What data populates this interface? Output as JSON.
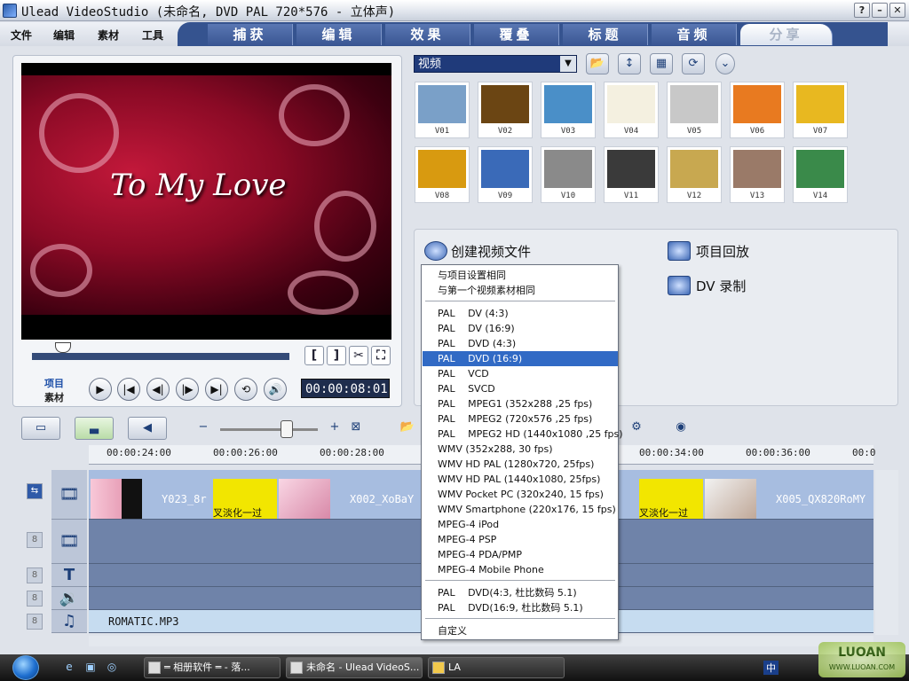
{
  "window": {
    "title": "Ulead VideoStudio (未命名, DVD PAL 720*576 - 立体声)",
    "help": "?",
    "minimize": "–",
    "close": "✕"
  },
  "menu": [
    "文件",
    "编辑",
    "素材",
    "工具"
  ],
  "tabs": [
    "捕获",
    "编辑",
    "效果",
    "覆叠",
    "标题",
    "音频",
    "分享"
  ],
  "active_tab": "分享",
  "preview": {
    "overlay_text": "To My Love",
    "mark_in": "[",
    "mark_out": "]",
    "mode_project": "项目",
    "mode_clip": "素材",
    "timecode": "00:00:08:01"
  },
  "playback_controls": [
    "▶",
    "|◀",
    "◀|",
    "|▶",
    "▶|",
    "⟲",
    "🔊"
  ],
  "library": {
    "category": "视频",
    "thumbs": [
      {
        "label": "V01",
        "color": "#7aa0c8"
      },
      {
        "label": "V02",
        "color": "#6b4513"
      },
      {
        "label": "V03",
        "color": "#4a8fc8"
      },
      {
        "label": "V04",
        "color": "#f4f0e0"
      },
      {
        "label": "V05",
        "color": "#c8c8c8"
      },
      {
        "label": "V06",
        "color": "#e87a20"
      },
      {
        "label": "V07",
        "color": "#e8b820"
      },
      {
        "label": "V08",
        "color": "#d89a10"
      },
      {
        "label": "V09",
        "color": "#3a6ab8"
      },
      {
        "label": "V10",
        "color": "#8a8a8a"
      },
      {
        "label": "V11",
        "color": "#3a3a3a"
      },
      {
        "label": "V12",
        "color": "#c8a850"
      },
      {
        "label": "V13",
        "color": "#9a7a68"
      },
      {
        "label": "V14",
        "color": "#3a8a4a"
      }
    ]
  },
  "share": {
    "create_video": "创建视频文件",
    "project_playback": "项目回放",
    "dv_record": "DV 录制"
  },
  "dropdown": {
    "groups": [
      [
        "与项目设置相同",
        "与第一个视频素材相同"
      ],
      [
        "PAL　 DV (4:3)",
        "PAL　 DV (16:9)",
        "PAL　 DVD (4:3)",
        "PAL　 DVD (16:9)",
        "PAL　 VCD",
        "PAL　 SVCD",
        "PAL　 MPEG1 (352x288 ,25 fps)",
        "PAL　 MPEG2 (720x576 ,25 fps)",
        "PAL　 MPEG2 HD (1440x1080 ,25 fps)",
        "WMV (352x288, 30 fps)",
        "WMV HD PAL (1280x720, 25fps)",
        "WMV HD PAL (1440x1080, 25fps)",
        "WMV Pocket PC (320x240, 15 fps)",
        "WMV Smartphone (220x176, 15 fps)",
        "MPEG-4 iPod",
        "MPEG-4 PSP",
        "MPEG-4 PDA/PMP",
        "MPEG-4 Mobile Phone"
      ],
      [
        "PAL　 DVD(4:3, 杜比数码 5.1)",
        "PAL　 DVD(16:9, 杜比数码 5.1)"
      ],
      [
        "自定义"
      ]
    ],
    "selected": "PAL　 DVD (16:9)"
  },
  "timeline": {
    "ruler": [
      "00:00:24:00",
      "00:00:26:00",
      "00:00:28:00",
      "00:00:34:00",
      "00:00:36:00",
      "00:0"
    ],
    "clip_labels": [
      "Y023_8r",
      "X002_XoBaY",
      "X005_QX820RoMY"
    ],
    "title_clip_text": "叉淡化一过",
    "music_clip": "ROMATIC.MP3",
    "track_icons": [
      "🎞",
      "🎞",
      "T",
      "🔉",
      "♫"
    ]
  },
  "taskbar": {
    "tasks": [
      "═ 相册软件 ═ - 落...",
      "未命名 - Ulead VideoS...",
      "LA"
    ],
    "tray_ime": "中",
    "watermark": "LUOAN",
    "watermark_url": "WWW.LUOAN.COM"
  },
  "colors": {
    "selection": "#316ac5",
    "tab_bar": "#35538f",
    "timeline_track": "#6f83a9"
  }
}
